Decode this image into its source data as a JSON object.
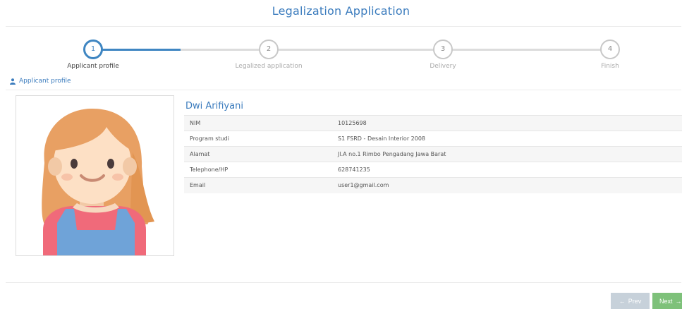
{
  "page": {
    "title": "Legalization Application"
  },
  "steps": [
    {
      "number": "1",
      "label": "Applicant profile"
    },
    {
      "number": "2",
      "label": "Legalized application"
    },
    {
      "number": "3",
      "label": "Delivery"
    },
    {
      "number": "4",
      "label": "Finish"
    }
  ],
  "section": {
    "title": "Applicant profile",
    "icon": "user-icon"
  },
  "profile": {
    "name": "Dwi Arifiyani",
    "rows": [
      {
        "key": "NIM",
        "value": "10125698"
      },
      {
        "key": "Program studi",
        "value": "S1 FSRD - Desain Interior 2008"
      },
      {
        "key": "Alamat",
        "value": "Jl.A no.1 Rimbo Pengadang Jawa Barat"
      },
      {
        "key": "Telephone/HP",
        "value": "628741235"
      },
      {
        "key": "Email",
        "value": "user1@gmail.com"
      }
    ]
  },
  "nav": {
    "prev_label": "Prev",
    "next_label": "Next"
  },
  "colors": {
    "accent": "#3f86c2",
    "next": "#7ec17a",
    "prev": "#c7d1da"
  }
}
